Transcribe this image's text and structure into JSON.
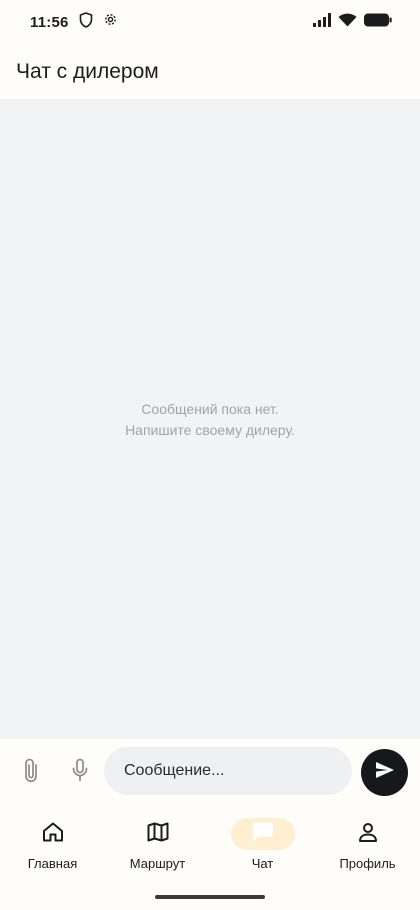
{
  "status_bar": {
    "time": "11:56",
    "icons": [
      "shield-icon",
      "settings-gear-icon",
      "signal-icon",
      "wifi-icon",
      "battery-icon"
    ]
  },
  "header": {
    "title": "Чат с дилером"
  },
  "empty_state": {
    "line1": "Сообщений пока нет.",
    "line2": "Напишите своему дилеру."
  },
  "composer": {
    "placeholder": "Сообщение...",
    "value": "",
    "attach_icon": "paperclip-icon",
    "mic_icon": "microphone-icon",
    "send_icon": "send-icon"
  },
  "nav": {
    "items": [
      {
        "label": "Главная",
        "icon": "home-icon",
        "active": false
      },
      {
        "label": "Маршрут",
        "icon": "map-icon",
        "active": false
      },
      {
        "label": "Чат",
        "icon": "chat-icon",
        "active": true
      },
      {
        "label": "Профиль",
        "icon": "profile-icon",
        "active": false
      }
    ]
  },
  "colors": {
    "background": "#fffdf9",
    "messages_bg": "#f2f3f5",
    "active_nav_pill": "#fdefcf",
    "send_button": "#16181c",
    "muted_text": "#a0a3a8"
  }
}
